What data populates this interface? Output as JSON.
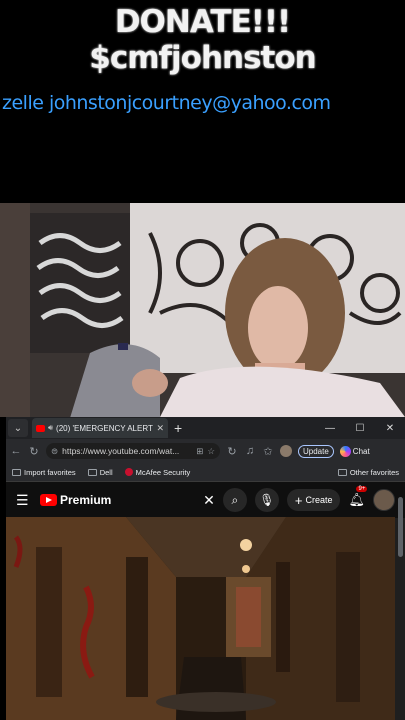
{
  "overlay": {
    "donate_text": "DONATE!!! $cmfjohnston",
    "zelle_text": "zelle johnstonjcourtney@yahoo.com"
  },
  "browser": {
    "tab": {
      "title": "(20) 'EMERGENCY ALERT Activ",
      "favicon": "youtube-icon"
    },
    "address": {
      "url": "https://www.youtube.com/wat..."
    },
    "update_label": "Update",
    "chat_label": "Chat",
    "favorites": [
      {
        "label": "Import favorites"
      },
      {
        "label": "Dell"
      },
      {
        "label": "McAfee Security"
      }
    ],
    "other_favorites_label": "Other favorites"
  },
  "youtube": {
    "brand_label": "Premium",
    "create_label": "Create",
    "notification_count": "9+"
  },
  "colors": {
    "zelle": "#3aa0ff",
    "youtube_red": "#ff0000",
    "yt_bg": "#0f0f0f"
  }
}
